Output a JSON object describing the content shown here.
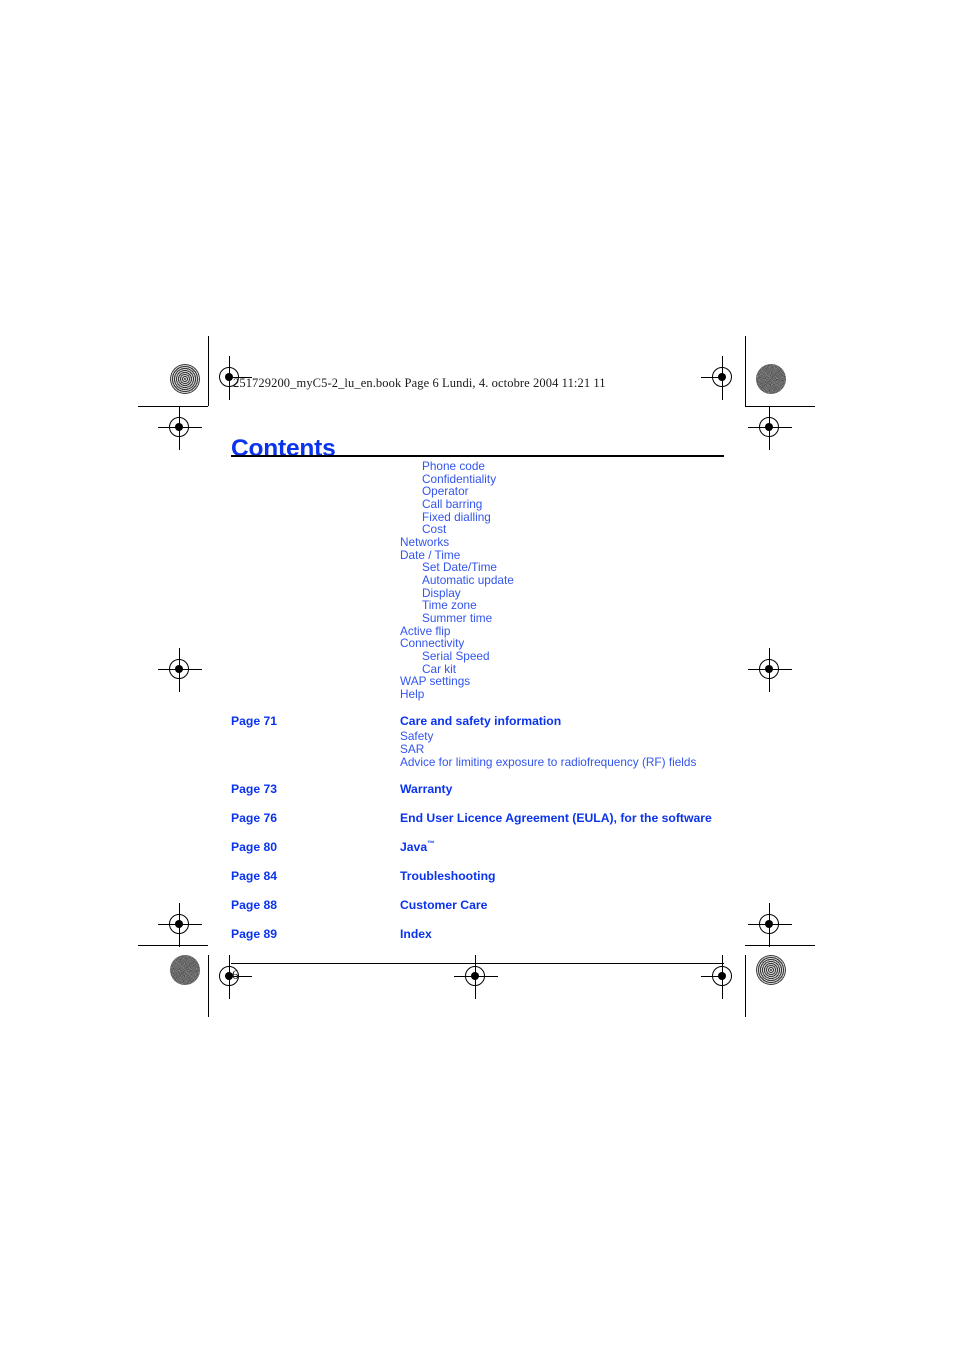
{
  "document": {
    "file_header": "251729200_myC5-2_lu_en.book  Page 6  Lundi, 4. octobre 2004  11:21 11",
    "title": "Contents",
    "folio": "6"
  },
  "colors": {
    "heading_blue": "#0a33ee",
    "entry_blue": "#3355ee",
    "rule_black": "#000000"
  },
  "toc": {
    "continued_items": [
      {
        "label": "Phone code",
        "level": 2
      },
      {
        "label": "Confidentiality",
        "level": 2
      },
      {
        "label": "Operator",
        "level": 2
      },
      {
        "label": "Call barring",
        "level": 2
      },
      {
        "label": "Fixed dialling",
        "level": 2
      },
      {
        "label": "Cost",
        "level": 2
      },
      {
        "label": "Networks",
        "level": 1
      },
      {
        "label": "Date / Time",
        "level": 1
      },
      {
        "label": "Set Date/Time",
        "level": 2
      },
      {
        "label": "Automatic update",
        "level": 2
      },
      {
        "label": "Display",
        "level": 2
      },
      {
        "label": "Time zone",
        "level": 2
      },
      {
        "label": "Summer time",
        "level": 2
      },
      {
        "label": "Active flip",
        "level": 1
      },
      {
        "label": "Connectivity",
        "level": 1
      },
      {
        "label": "Serial Speed",
        "level": 2
      },
      {
        "label": "Car kit",
        "level": 2
      },
      {
        "label": "WAP settings",
        "level": 1
      },
      {
        "label": "Help",
        "level": 1
      }
    ],
    "entries": [
      {
        "page": "Page 71",
        "title": "Care and safety information",
        "subs": [
          "Safety",
          "SAR",
          "Advice for limiting exposure to radiofrequency (RF) fields"
        ]
      },
      {
        "page": "Page 73",
        "title": "Warranty",
        "subs": []
      },
      {
        "page": "Page 76",
        "title": "End User Licence Agreement (EULA), for the software",
        "subs": []
      },
      {
        "page": "Page 80",
        "title": "Java",
        "title_sup": "™",
        "subs": []
      },
      {
        "page": "Page 84",
        "title": "Troubleshooting",
        "subs": []
      },
      {
        "page": "Page 88",
        "title": "Customer Care",
        "subs": []
      },
      {
        "page": "Page 89",
        "title": "Index",
        "subs": []
      }
    ]
  }
}
